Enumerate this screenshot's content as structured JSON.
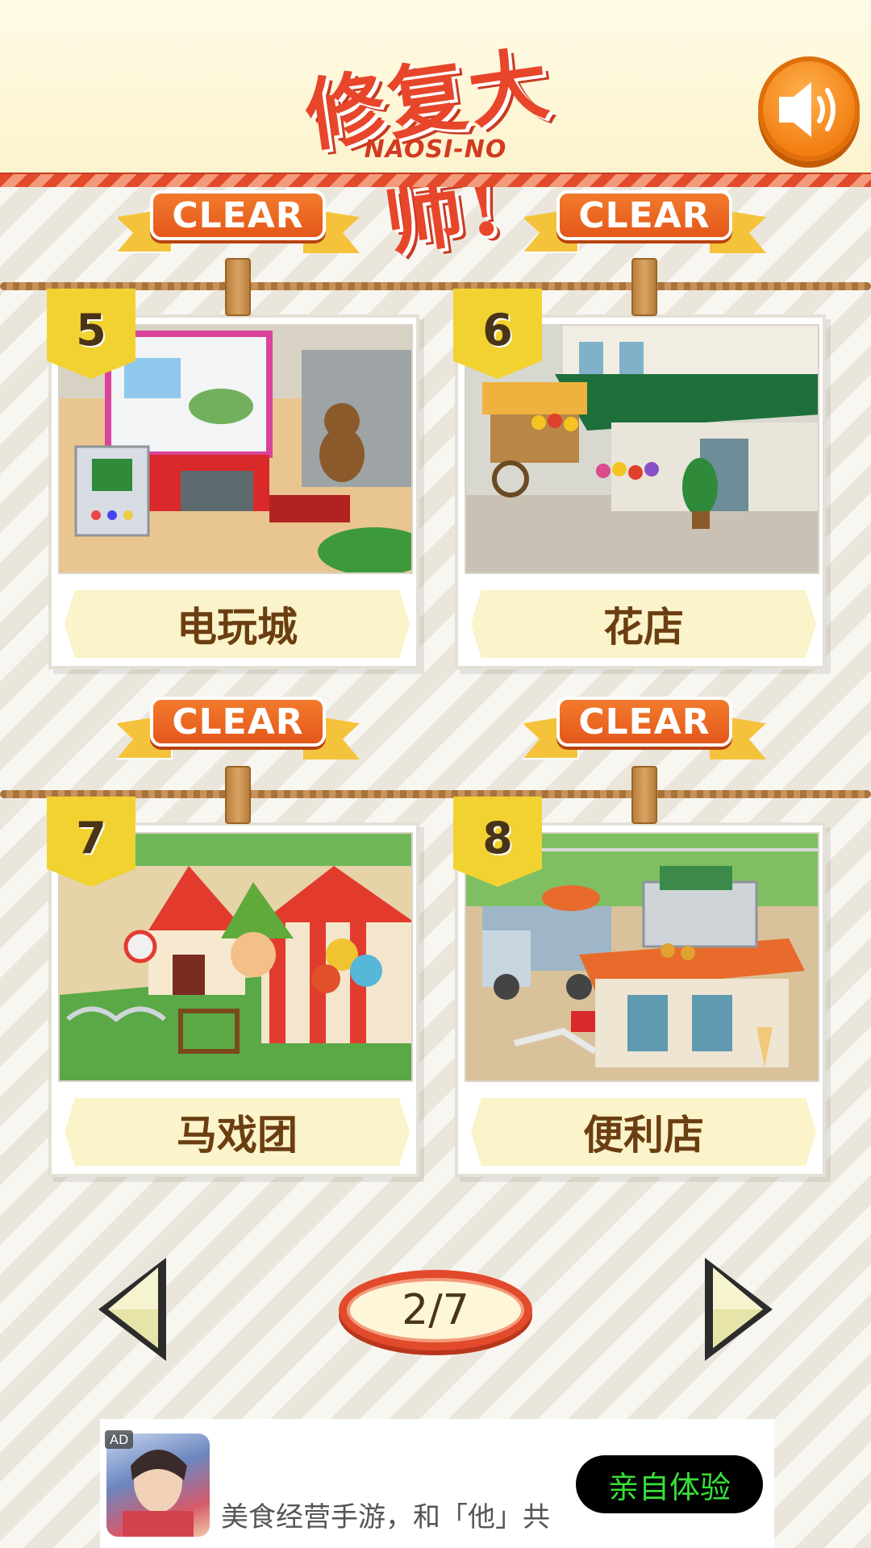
{
  "header": {
    "logo_cn": "修复大师!",
    "logo_en": "NAOSI-NO",
    "sound_icon": "speaker-icon"
  },
  "levels": [
    {
      "number": "5",
      "name": "电玩城",
      "status": "CLEAR"
    },
    {
      "number": "6",
      "name": "花店",
      "status": "CLEAR"
    },
    {
      "number": "7",
      "name": "马戏团",
      "status": "CLEAR"
    },
    {
      "number": "8",
      "name": "便利店",
      "status": "CLEAR"
    }
  ],
  "pager": {
    "current_page": 2,
    "total_pages": 7,
    "label": "2/7",
    "prev_icon": "triangle-left-icon",
    "next_icon": "triangle-right-icon"
  },
  "ad": {
    "tag": "AD",
    "text": "美食经营手游，和「他」共",
    "cta": "亲自体验"
  },
  "colors": {
    "accent_red": "#e24a2c",
    "clear_orange": "#f27b2c",
    "flag_yellow": "#f2d231",
    "label_brown": "#6b3e12",
    "cta_green": "#38e038"
  }
}
